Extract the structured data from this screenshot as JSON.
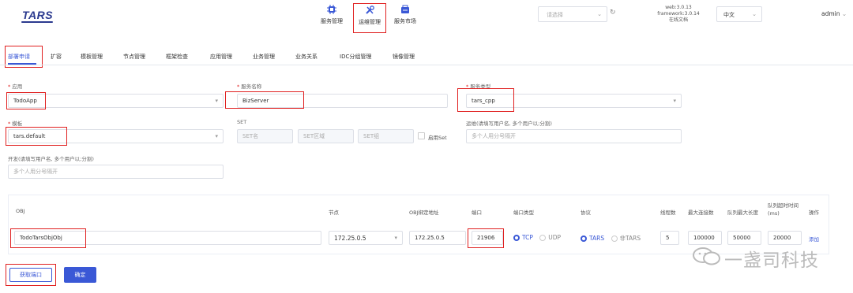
{
  "header": {
    "logo": "TARS",
    "nav": [
      {
        "label": "服务管理",
        "icon": "chip-icon"
      },
      {
        "label": "运维管理",
        "icon": "tools-icon"
      },
      {
        "label": "服务市场",
        "icon": "market-icon"
      }
    ],
    "select_placeholder": "请选择",
    "version_web": "web:3.0.13",
    "version_framework": "framework:3.0.14",
    "docs_link": "在线文档",
    "language": "中文",
    "user": "admin"
  },
  "tabs": [
    "部署申请",
    "扩容",
    "模板管理",
    "节点管理",
    "框架检查",
    "应用管理",
    "业务管理",
    "业务关系",
    "IDC分组管理",
    "镜像管理"
  ],
  "form": {
    "app_label": "应用",
    "app_value": "TodoApp",
    "service_name_label": "服务名称",
    "service_name_value": "BizServer",
    "service_type_label": "服务类型",
    "service_type_value": "tars_cpp",
    "template_label": "模板",
    "template_value": "tars.default",
    "set_label": "SET",
    "set_name_ph": "SET名",
    "set_area_ph": "SET区域",
    "set_group_ph": "SET组",
    "enable_set": "启用Set",
    "ops_label": "运维(请填写用户名, 多个用户以;分割)",
    "ops_ph": "多个人用分号隔开",
    "dev_label": "开发(请填写用户名, 多个用户以;分割)",
    "dev_ph": "多个人用分号隔开"
  },
  "table": {
    "headers": {
      "obj": "OBJ",
      "node": "节点",
      "bind": "OBJ绑定地址",
      "port": "端口",
      "port_type": "端口类型",
      "protocol": "协议",
      "threads": "线程数",
      "max_conn": "最大连接数",
      "queue_len": "队列最大长度",
      "queue_timeout_1": "队列超时时间",
      "queue_timeout_2": "(ms)",
      "action": "操作"
    },
    "row": {
      "obj": "TodoTarsObjObj",
      "node": "172.25.0.5",
      "bind": "172.25.0.5",
      "port": "21906",
      "tcp": "TCP",
      "udp": "UDP",
      "tars": "TARS",
      "non_tars": "非TARS",
      "threads": "5",
      "max_conn": "100000",
      "queue_len": "50000",
      "queue_timeout": "20000",
      "add": "添加"
    }
  },
  "buttons": {
    "get_port": "获取端口",
    "confirm": "确定"
  },
  "watermark": "一盏司科技",
  "colors": {
    "primary": "#3a58d6",
    "highlight": "#e02020",
    "brand": "#2b3a8f"
  }
}
